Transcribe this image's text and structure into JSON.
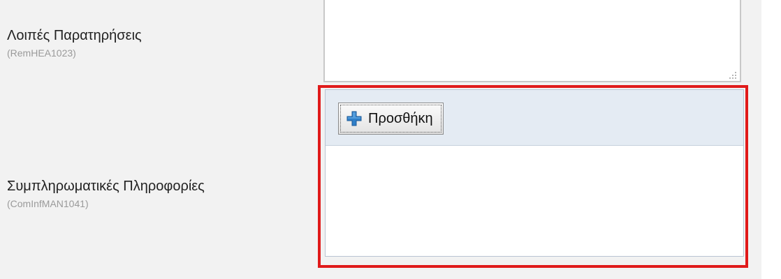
{
  "fields": [
    {
      "label": "Λοιπές Παρατηρήσεις",
      "code": "(RemHEA1023)",
      "textarea_value": ""
    },
    {
      "label": "Συμπληρωματικές Πληροφορίες",
      "code": "(ComInfMAN1041)",
      "add_button_label": "Προσθήκη",
      "add_icon": "plus-icon"
    }
  ],
  "colors": {
    "highlight": "#e01a1a",
    "toolbar": "#e4ebf3",
    "plus_icon": "#2f7fc8"
  }
}
